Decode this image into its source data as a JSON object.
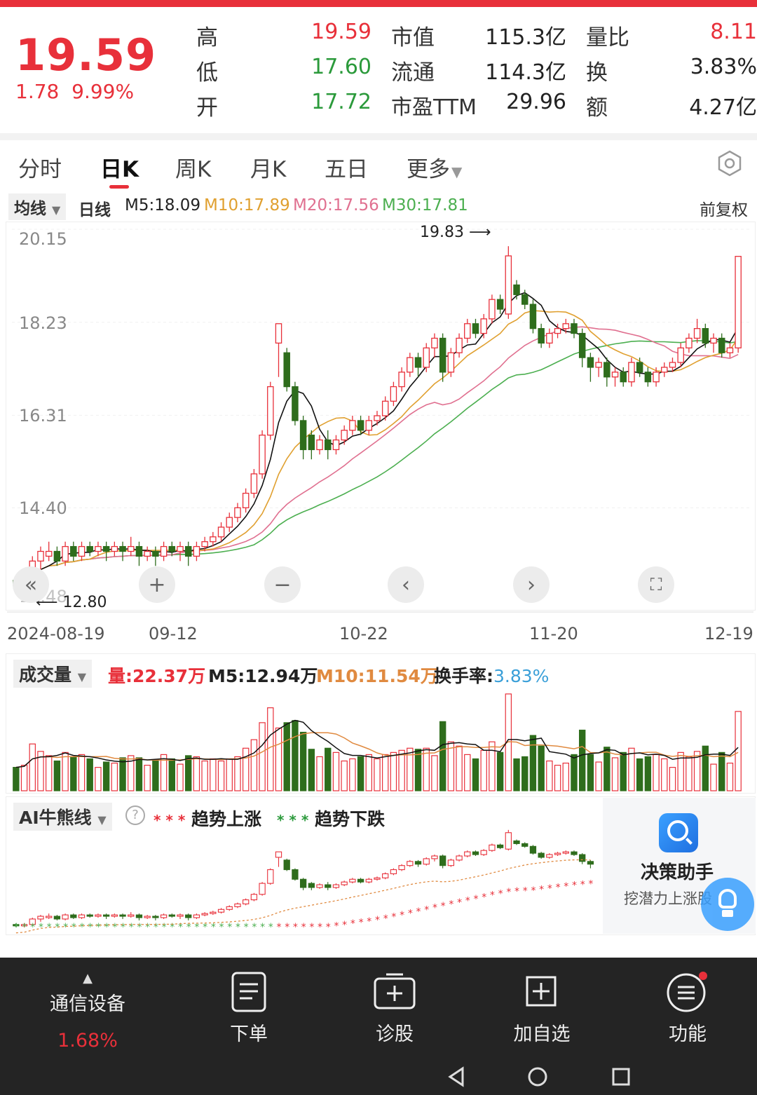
{
  "quote": {
    "price": "19.59",
    "change": "1.78",
    "change_pct": "9.99%",
    "rows": [
      {
        "label1": "高",
        "val1": "19.59",
        "label2": "市值",
        "val2": "115.3亿",
        "label3": "量比",
        "val3": "8.11"
      },
      {
        "label1": "低",
        "val1": "17.60",
        "label2": "流通",
        "val2": "114.3亿",
        "label3": "换",
        "val3": "3.83%"
      },
      {
        "label1": "开",
        "val1": "17.72",
        "label2": "市盈TTM",
        "val2": "29.96",
        "label3": "额",
        "val3": "4.27亿"
      }
    ]
  },
  "tabs": [
    "分时",
    "日K",
    "周K",
    "月K",
    "五日",
    "更多"
  ],
  "ma_bar": {
    "dropdown": "均线",
    "type": "日线",
    "m5": "M5:18.09",
    "m10": "M10:17.89",
    "m20": "M20:17.56",
    "m30": "M30:17.81",
    "adjust": "前复权"
  },
  "chart_data": {
    "type": "candlestick",
    "y_ticks": [
      "20.15",
      "18.23",
      "16.31",
      "14.40",
      "12.48"
    ],
    "ylim": [
      12.48,
      20.15
    ],
    "x_ticks": [
      "2024-08-19",
      "09-12",
      "10-22",
      "11-20",
      "12-19"
    ],
    "high_annotation": "19.83",
    "low_annotation": "12.80",
    "candles": [
      [
        12.9,
        12.8,
        13.0,
        12.7
      ],
      [
        12.8,
        12.9,
        13.0,
        12.7
      ],
      [
        12.9,
        13.3,
        13.4,
        12.8
      ],
      [
        13.3,
        13.5,
        13.6,
        13.1
      ],
      [
        13.4,
        13.5,
        13.7,
        13.3
      ],
      [
        13.5,
        13.3,
        13.6,
        13.2
      ],
      [
        13.3,
        13.6,
        13.7,
        13.2
      ],
      [
        13.6,
        13.4,
        13.7,
        13.3
      ],
      [
        13.4,
        13.6,
        13.7,
        13.3
      ],
      [
        13.6,
        13.5,
        13.7,
        13.4
      ],
      [
        13.5,
        13.6,
        13.7,
        13.4
      ],
      [
        13.6,
        13.5,
        13.7,
        13.3
      ],
      [
        13.5,
        13.6,
        13.7,
        13.4
      ],
      [
        13.6,
        13.5,
        13.7,
        13.3
      ],
      [
        13.5,
        13.6,
        13.8,
        13.4
      ],
      [
        13.6,
        13.4,
        13.7,
        13.2
      ],
      [
        13.4,
        13.5,
        13.6,
        13.3
      ],
      [
        13.5,
        13.4,
        13.6,
        13.2
      ],
      [
        13.4,
        13.6,
        13.7,
        13.3
      ],
      [
        13.6,
        13.5,
        13.7,
        13.4
      ],
      [
        13.5,
        13.6,
        13.7,
        13.3
      ],
      [
        13.6,
        13.4,
        13.7,
        13.2
      ],
      [
        13.4,
        13.6,
        13.7,
        13.3
      ],
      [
        13.6,
        13.7,
        13.8,
        13.5
      ],
      [
        13.7,
        13.8,
        13.9,
        13.6
      ],
      [
        13.8,
        14.0,
        14.1,
        13.7
      ],
      [
        14.0,
        14.2,
        14.3,
        13.9
      ],
      [
        14.2,
        14.4,
        14.5,
        14.1
      ],
      [
        14.4,
        14.7,
        14.8,
        14.3
      ],
      [
        14.7,
        15.1,
        15.2,
        14.6
      ],
      [
        15.1,
        15.9,
        16.0,
        15.0
      ],
      [
        15.9,
        16.9,
        17.0,
        15.8
      ],
      [
        17.8,
        18.2,
        18.2,
        17.1
      ],
      [
        17.6,
        16.9,
        17.7,
        16.8
      ],
      [
        16.9,
        16.2,
        17.0,
        16.1
      ],
      [
        16.2,
        15.6,
        16.3,
        15.4
      ],
      [
        15.9,
        15.6,
        16.0,
        15.4
      ],
      [
        15.6,
        15.8,
        15.9,
        15.5
      ],
      [
        15.8,
        15.6,
        16.0,
        15.4
      ],
      [
        15.6,
        15.8,
        15.9,
        15.5
      ],
      [
        15.8,
        16.0,
        16.1,
        15.7
      ],
      [
        16.0,
        16.2,
        16.3,
        15.9
      ],
      [
        16.2,
        16.0,
        16.3,
        15.9
      ],
      [
        16.0,
        16.2,
        16.3,
        15.9
      ],
      [
        16.2,
        16.3,
        16.4,
        16.1
      ],
      [
        16.3,
        16.6,
        16.7,
        16.2
      ],
      [
        16.6,
        16.9,
        17.0,
        16.5
      ],
      [
        16.9,
        17.2,
        17.3,
        16.8
      ],
      [
        17.2,
        17.5,
        17.6,
        17.1
      ],
      [
        17.5,
        17.3,
        17.6,
        17.1
      ],
      [
        17.3,
        17.7,
        17.8,
        17.2
      ],
      [
        17.7,
        17.9,
        18.0,
        17.5
      ],
      [
        17.9,
        17.2,
        18.0,
        17.0
      ],
      [
        17.2,
        17.6,
        17.7,
        17.1
      ],
      [
        17.6,
        17.9,
        18.0,
        17.5
      ],
      [
        17.9,
        18.2,
        18.3,
        17.8
      ],
      [
        18.2,
        18.0,
        18.3,
        17.9
      ],
      [
        18.0,
        18.3,
        18.4,
        17.9
      ],
      [
        18.3,
        18.7,
        18.8,
        18.2
      ],
      [
        18.7,
        18.5,
        18.8,
        18.4
      ],
      [
        18.4,
        19.6,
        19.8,
        18.3
      ],
      [
        19.0,
        18.8,
        19.1,
        18.7
      ],
      [
        18.8,
        18.6,
        18.9,
        18.5
      ],
      [
        18.6,
        18.1,
        18.7,
        18.0
      ],
      [
        18.1,
        17.8,
        18.2,
        17.7
      ],
      [
        17.8,
        18.0,
        18.1,
        17.7
      ],
      [
        18.0,
        18.1,
        18.2,
        17.9
      ],
      [
        18.1,
        18.2,
        18.3,
        18.0
      ],
      [
        18.2,
        18.0,
        18.3,
        17.9
      ],
      [
        18.0,
        17.5,
        18.1,
        17.3
      ],
      [
        17.5,
        17.3,
        17.6,
        17.0
      ],
      [
        17.3,
        17.4,
        17.5,
        17.1
      ],
      [
        17.4,
        17.1,
        17.5,
        16.9
      ],
      [
        17.1,
        17.2,
        17.3,
        16.9
      ],
      [
        17.2,
        17.0,
        17.3,
        16.9
      ],
      [
        17.0,
        17.4,
        17.5,
        16.9
      ],
      [
        17.4,
        17.2,
        17.5,
        17.1
      ],
      [
        17.2,
        17.0,
        17.3,
        16.9
      ],
      [
        17.0,
        17.2,
        17.3,
        16.9
      ],
      [
        17.2,
        17.3,
        17.4,
        17.1
      ],
      [
        17.3,
        17.4,
        17.5,
        17.2
      ],
      [
        17.4,
        17.7,
        17.8,
        17.3
      ],
      [
        17.7,
        17.9,
        18.0,
        17.6
      ],
      [
        17.9,
        18.1,
        18.3,
        17.8
      ],
      [
        18.1,
        17.8,
        18.2,
        17.7
      ],
      [
        17.8,
        17.9,
        18.0,
        17.6
      ],
      [
        17.9,
        17.6,
        18.0,
        17.5
      ],
      [
        17.6,
        17.7,
        17.8,
        17.5
      ],
      [
        17.7,
        19.59,
        19.59,
        17.6
      ]
    ]
  },
  "volume": {
    "dropdown": "成交量",
    "vol": "量:22.37万",
    "m5": "M5:12.94万",
    "m10": "M10:11.54万",
    "turnover_label": "换手率:",
    "turnover_value": "3.83%"
  },
  "ai": {
    "dropdown": "AI牛熊线",
    "legend_up": "趋势上涨",
    "legend_down": "趋势下跌"
  },
  "assistant": {
    "title": "决策助手",
    "subtitle": "挖潜力上涨股"
  },
  "bottom": {
    "sector": "通信设备",
    "sector_pct": "1.68%",
    "items": [
      "下单",
      "诊股",
      "加自选",
      "功能"
    ]
  },
  "colors": {
    "up": "#e8303a",
    "down": "#2e6d1c",
    "m10": "#e0a030",
    "m20": "#e07090",
    "m30": "#4caf50"
  }
}
